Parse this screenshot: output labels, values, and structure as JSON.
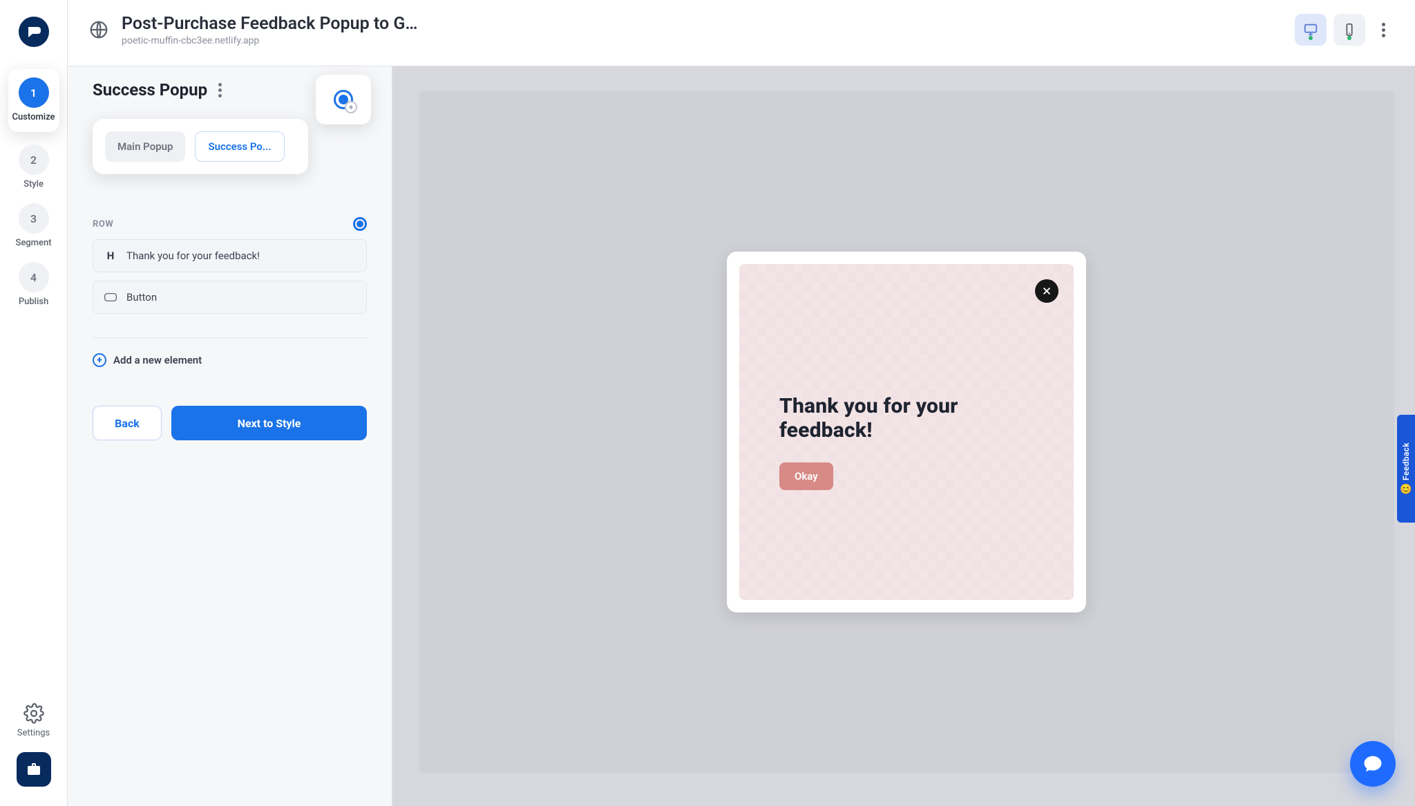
{
  "header": {
    "title": "Post-Purchase Feedback Popup to G...",
    "subtitle": "poetic-muffin-cbc3ee.netlify.app"
  },
  "steps": {
    "s1": {
      "num": "1",
      "label": "Customize"
    },
    "s2": {
      "num": "2",
      "label": "Style"
    },
    "s3": {
      "num": "3",
      "label": "Segment"
    },
    "s4": {
      "num": "4",
      "label": "Publish"
    }
  },
  "rail": {
    "settings": "Settings"
  },
  "editor": {
    "section_title": "Success Popup",
    "tabs": {
      "main": "Main Popup",
      "success": "Success Po..."
    },
    "row_label": "ROW",
    "elements": {
      "heading": "Thank you for your feedback!",
      "button": "Button"
    },
    "add_link": "Add a new element",
    "back": "Back",
    "next": "Next to Style"
  },
  "canvas": {
    "heading": "Thank you for your feedback!",
    "okay": "Okay"
  },
  "feedback_label": "Feedback"
}
